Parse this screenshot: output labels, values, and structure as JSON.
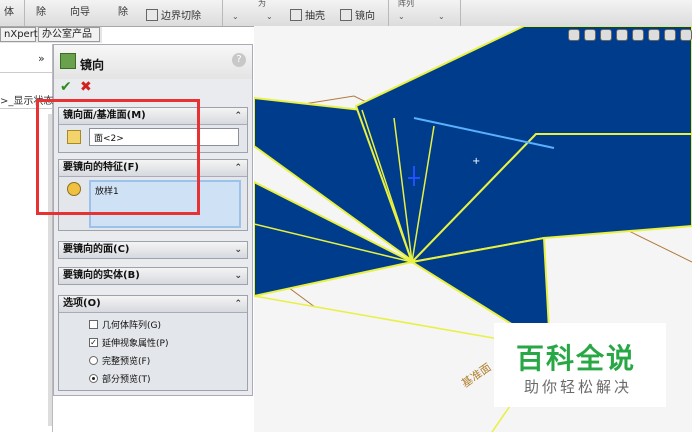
{
  "toolbar": {
    "items": [
      {
        "label": "体"
      },
      {
        "label": "除"
      },
      {
        "label": "向导"
      },
      {
        "label": "除"
      },
      {
        "label": "边界切除"
      },
      {
        "label": "抽壳"
      },
      {
        "label": "镜向"
      }
    ],
    "top_labels": [
      "为",
      "阵列"
    ]
  },
  "tabs": [
    "nXpert",
    "办公室产品"
  ],
  "tree": {
    "expand_symbol": "»",
    "crumb": ">_显示状态"
  },
  "property_manager": {
    "title": "镜向",
    "help": "?",
    "ok_symbol": "✔",
    "cancel_symbol": "✖",
    "groups": {
      "mirror_face": {
        "label": "镜向面/基准面(M)",
        "value": "面<2>"
      },
      "features": {
        "label": "要镜向的特征(F)",
        "value": "放样1"
      },
      "faces": {
        "label": "要镜向的面(C)"
      },
      "bodies": {
        "label": "要镜向的实体(B)"
      },
      "options": {
        "label": "选项(O)",
        "geometry_pattern": "几何体阵列(G)",
        "propagate_visual": "延伸视象属性(P)",
        "full_preview": "完整预览(F)",
        "partial_preview": "部分预览(T)"
      }
    },
    "expand_arrows": {
      "up": "⌃",
      "down": "⌄"
    }
  },
  "viewport": {
    "plane_label": "基准面",
    "origin_marker": "+"
  },
  "watermark": {
    "title": "百科全说",
    "subtitle": "助你轻松解决"
  },
  "colors": {
    "shape_fill": "#003c8c",
    "edge_yellow": "#e8f040",
    "highlight_red": "#e63232",
    "watermark_green": "#28a745"
  }
}
